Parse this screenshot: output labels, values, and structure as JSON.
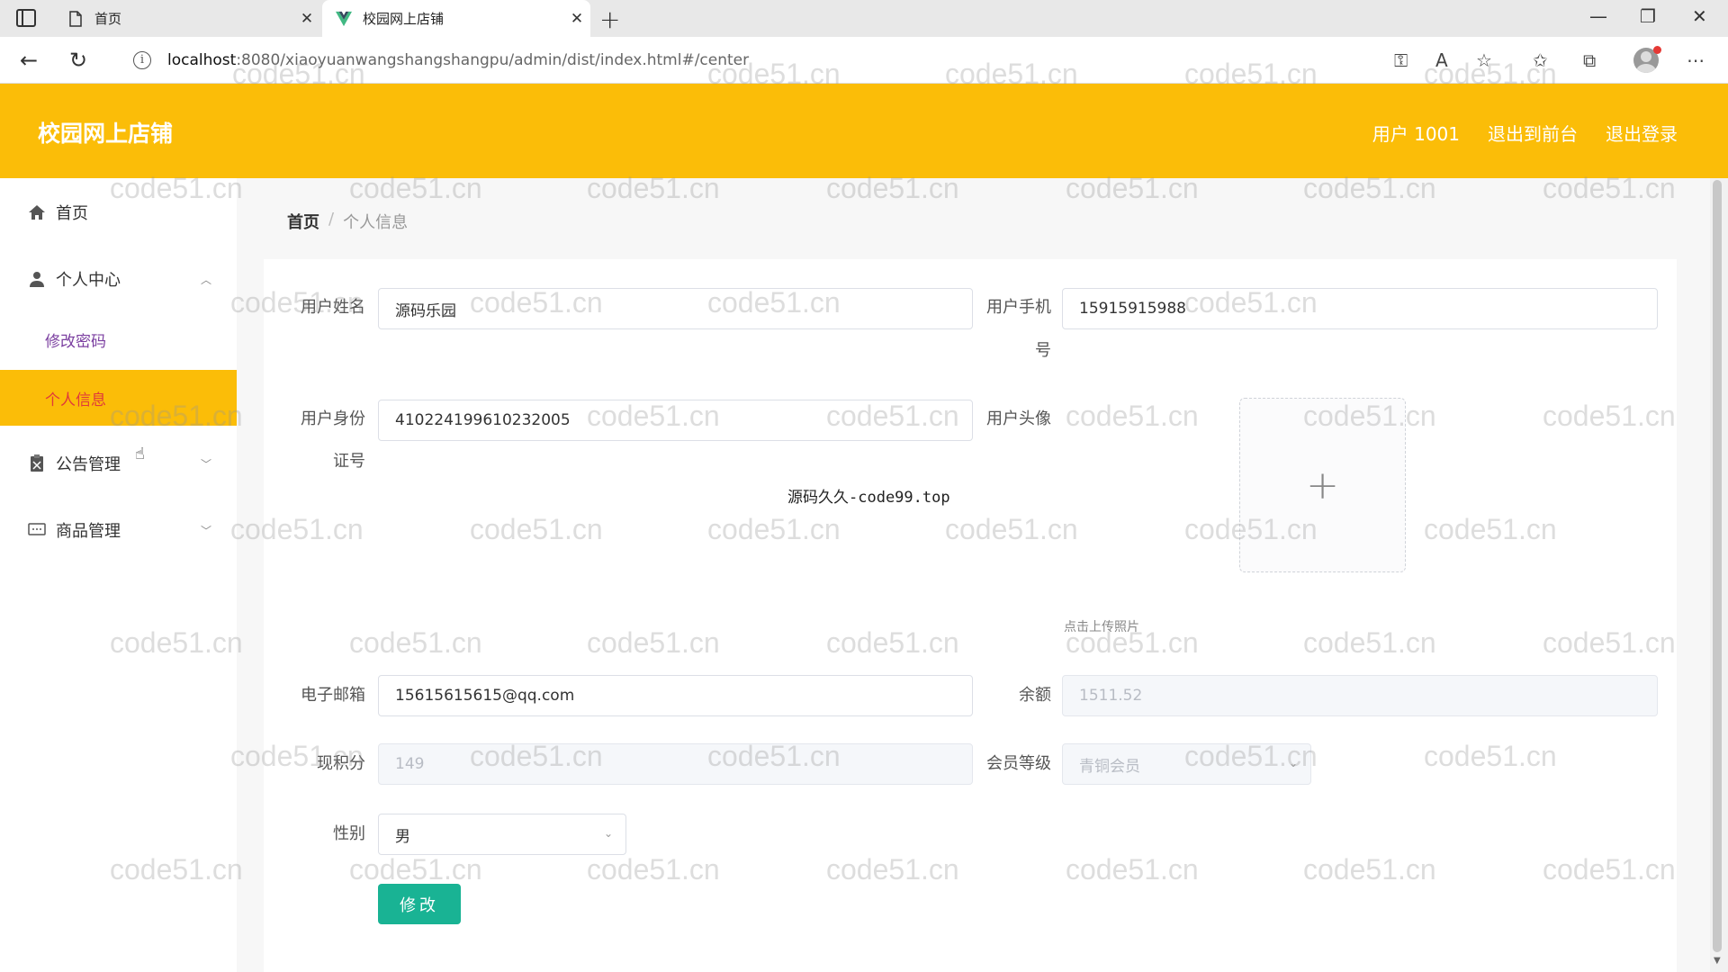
{
  "browser": {
    "tabs": [
      {
        "title": "首页",
        "icon": "page-icon"
      },
      {
        "title": "校园网上店铺",
        "icon": "vue-logo-icon"
      }
    ],
    "new_tab": "+",
    "url_host": "localhost",
    "url_path": ":8080/xiaoyuanwangshangshangpu/admin/dist/index.html#/center"
  },
  "header": {
    "title": "校园网上店铺",
    "user": "用户 1001",
    "back_to_front": "退出到前台",
    "logout": "退出登录"
  },
  "sidebar": {
    "home": "首页",
    "personal_center": "个人中心",
    "change_password": "修改密码",
    "personal_info": "个人信息",
    "notice_mgmt": "公告管理",
    "goods_mgmt": "商品管理"
  },
  "breadcrumb": {
    "home": "首页",
    "sep": "/",
    "current": "个人信息"
  },
  "form": {
    "username_label": "用户姓名",
    "username": "源码乐园",
    "phone_label_1": "用户手机",
    "phone_label_2": "号",
    "phone": "15915915988",
    "idcard_label_1": "用户身份",
    "idcard_label_2": "证号",
    "idcard": "410224199610232005",
    "avatar_label": "用户头像",
    "upload_plus": "+",
    "upload_tip": "点击上传照片",
    "email_label": "电子邮箱",
    "email": "15615615615@qq.com",
    "balance_label": "余额",
    "balance": "1511.52",
    "points_label": "现积分",
    "points": "149",
    "level_label": "会员等级",
    "level": "青铜会员",
    "gender_label": "性别",
    "gender": "男",
    "submit": "修改"
  },
  "promo_text": "源码久久-code99.top",
  "watermark": "code51.cn",
  "colors": {
    "header": "#fbbd08",
    "active_text": "#e03a3a",
    "submit": "#19b394",
    "submenu_link": "#7b3fa0"
  }
}
